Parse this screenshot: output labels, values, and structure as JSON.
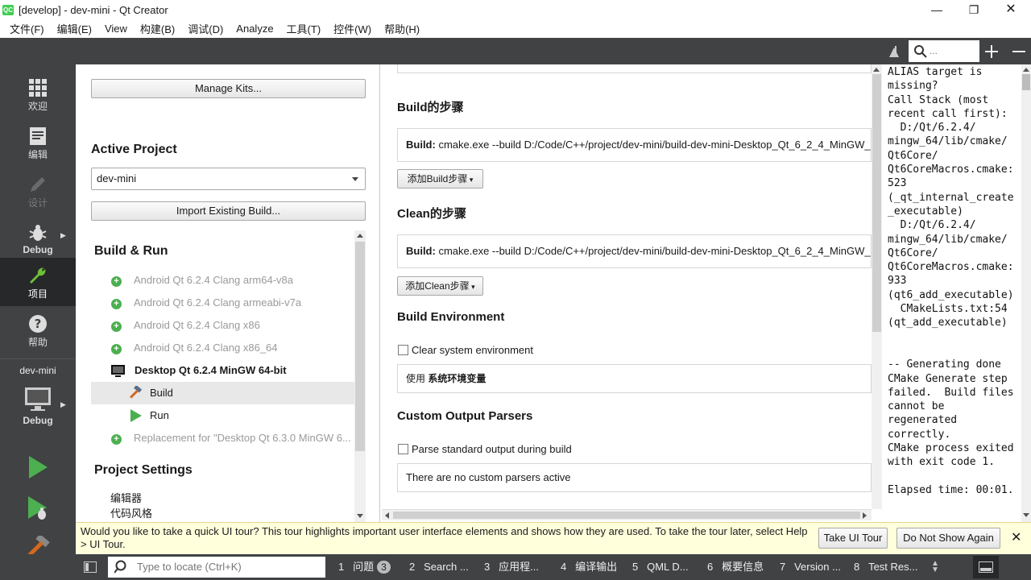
{
  "window": {
    "title": "[develop] - dev-mini - Qt Creator",
    "app_icon": "QC"
  },
  "menubar": [
    "文件(F)",
    "编辑(E)",
    "View",
    "构建(B)",
    "调试(D)",
    "Analyze",
    "工具(T)",
    "控件(W)",
    "帮助(H)"
  ],
  "modes": [
    {
      "label": "欢迎",
      "icon": "grid-icon"
    },
    {
      "label": "编辑",
      "icon": "document-icon"
    },
    {
      "label": "设计",
      "icon": "pencil-icon"
    },
    {
      "label": "Debug",
      "icon": "bug-icon"
    },
    {
      "label": "项目",
      "icon": "wrench-icon"
    },
    {
      "label": "帮助",
      "icon": "help-icon"
    }
  ],
  "kit_selector": {
    "project": "dev-mini",
    "mode": "Debug"
  },
  "left": {
    "manage_kits": "Manage Kits...",
    "active_project_title": "Active Project",
    "project_combo": "dev-mini",
    "import_build": "Import Existing Build...",
    "build_run_title": "Build & Run",
    "kits": [
      "Android Qt 6.2.4 Clang arm64-v8a",
      "Android Qt 6.2.4 Clang armeabi-v7a",
      "Android Qt 6.2.4 Clang x86",
      "Android Qt 6.2.4 Clang x86_64"
    ],
    "active_kit": "Desktop Qt 6.2.4 MinGW 64-bit",
    "build_label": "Build",
    "run_label": "Run",
    "replacement_kit": "Replacement for \"Desktop Qt 6.3.0 MinGW 6...",
    "project_settings_title": "Project Settings",
    "settings_items": [
      "编辑器",
      "代码风格"
    ]
  },
  "main": {
    "build_steps_title": "Build的步骤",
    "build_step_prefix": "Build:",
    "build_step_cmd": " cmake.exe --build D:/Code/C++/project/dev-mini/build-dev-mini-Desktop_Qt_6_2_4_MinGW_",
    "add_build_step": "添加Build步骤",
    "clean_steps_title": "Clean的步骤",
    "clean_step_prefix": "Build:",
    "clean_step_cmd": " cmake.exe --build D:/Code/C++/project/dev-mini/build-dev-mini-Desktop_Qt_6_2_4_MinGW_",
    "add_clean_step": "添加Clean步骤",
    "build_env_title": "Build Environment",
    "clear_env": "Clear system environment",
    "env_prefix": "使用 ",
    "env_value": "系统环境变量",
    "parsers_title": "Custom Output Parsers",
    "parse_std": "Parse standard output during build",
    "no_parsers": "There are no custom parsers active"
  },
  "output": {
    "search_placeholder": "...",
    "lines": "ALIAS target is\nmissing?\nCall Stack (most\nrecent call first):\n  D:/Qt/6.2.4/\nmingw_64/lib/cmake/\nQt6Core/\nQt6CoreMacros.cmake:\n523\n(_qt_internal_create\n_executable)\n  D:/Qt/6.2.4/\nmingw_64/lib/cmake/\nQt6Core/\nQt6CoreMacros.cmake:\n933\n(qt6_add_executable)\n  CMakeLists.txt:54\n(qt_add_executable)\n\n\n-- Generating done\nCMake Generate step\nfailed.  Build files\ncannot be\nregenerated\ncorrectly.\nCMake process exited\nwith exit code 1.\n\nElapsed time: 00:01."
  },
  "tour": {
    "text": "Would you like to take a quick UI tour? This tour highlights important user interface elements and shows how they are used. To take the tour later, select Help > UI Tour.",
    "take": "Take UI Tour",
    "dont_show": "Do Not Show Again"
  },
  "status": {
    "locate_placeholder": "Type to locate (Ctrl+K)",
    "tabs": [
      {
        "num": "1",
        "label": "问题",
        "badge": "3"
      },
      {
        "num": "2",
        "label": "Search ..."
      },
      {
        "num": "3",
        "label": "应用程..."
      },
      {
        "num": "4",
        "label": "编译输出"
      },
      {
        "num": "5",
        "label": "QML D..."
      },
      {
        "num": "6",
        "label": "概要信息"
      },
      {
        "num": "7",
        "label": "Version ..."
      },
      {
        "num": "8",
        "label": "Test Res..."
      }
    ]
  },
  "colors": {
    "sidebar": "#404244",
    "active_mode": "#262829",
    "run_green": "#4caf50",
    "tour_bg": "#ffffdc"
  }
}
